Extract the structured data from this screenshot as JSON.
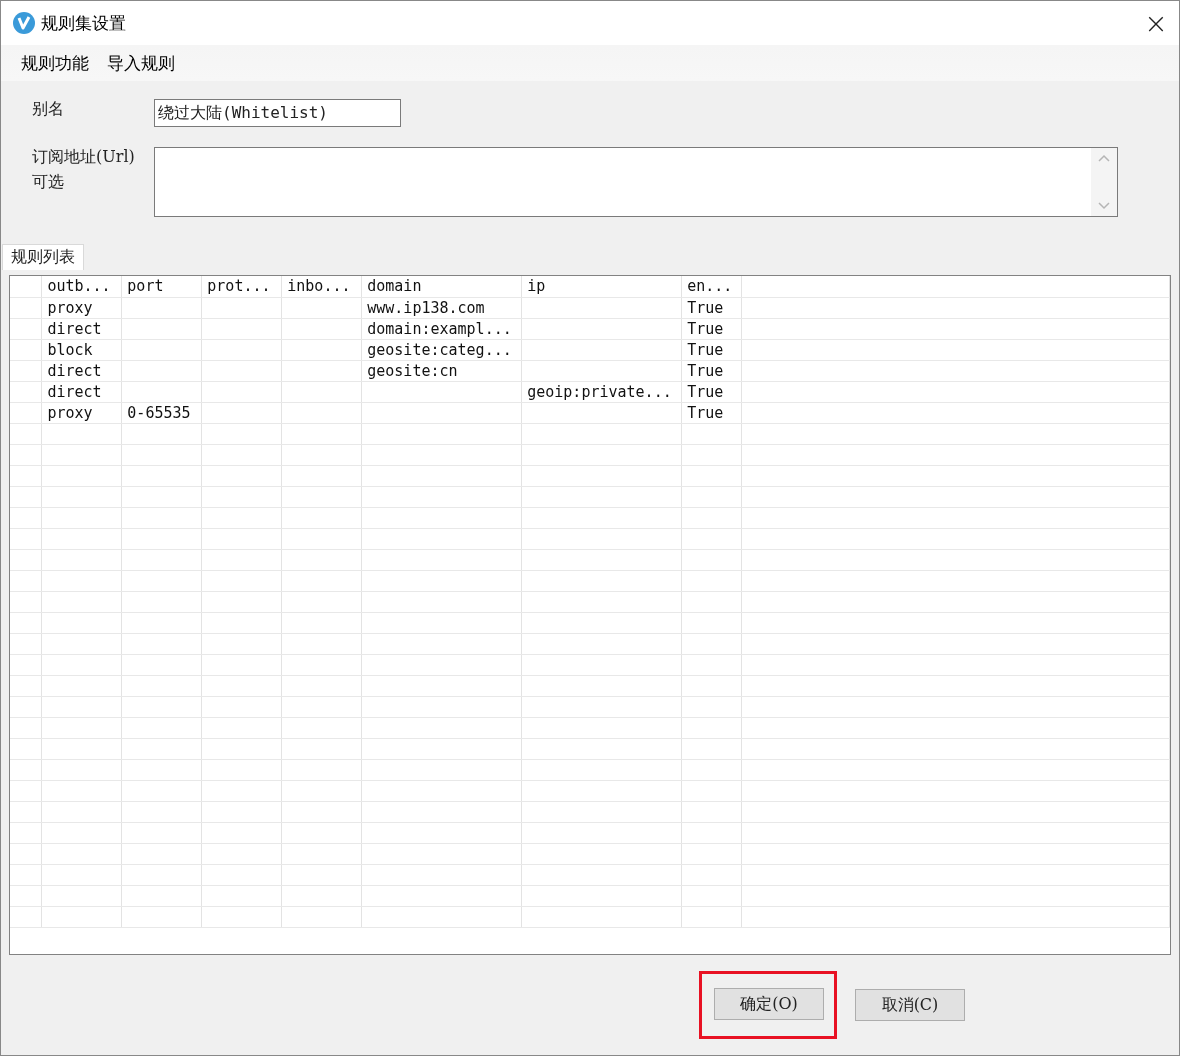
{
  "window": {
    "title": "规则集设置",
    "close": "×"
  },
  "menu": [
    "规则功能",
    "导入规则"
  ],
  "form": {
    "alias_label": "别名",
    "alias_value": "绕过大陆(Whitelist)",
    "url_label": "订阅地址(Url)",
    "url_hint": "可选"
  },
  "tabs": [
    {
      "label": "规则列表",
      "selected": true
    }
  ],
  "table": {
    "columns": [
      "outb...",
      "port",
      "prot...",
      "inbo...",
      "domain",
      "ip",
      "en..."
    ],
    "rows": [
      {
        "column_1": "proxy",
        "column_5": "www.ip138.com",
        "column_7": "True"
      },
      {
        "column_1": "direct",
        "column_5": "domain:exampl...",
        "column_7": "True"
      },
      {
        "column_1": "block",
        "column_5": "geosite:categ...",
        "column_7": "True"
      },
      {
        "column_1": "direct",
        "column_5": "geosite:cn",
        "column_7": "True"
      },
      {
        "column_1": "direct",
        "column_6": "geoip:private...",
        "column_7": "True"
      },
      {
        "column_1": "proxy",
        "column_2": "0-65535",
        "column_7": "True"
      }
    ]
  },
  "buttons": [
    {
      "label": "确定(O)",
      "highlighted": true
    },
    {
      "label": "取消(C)",
      "highlighted": false
    }
  ]
}
